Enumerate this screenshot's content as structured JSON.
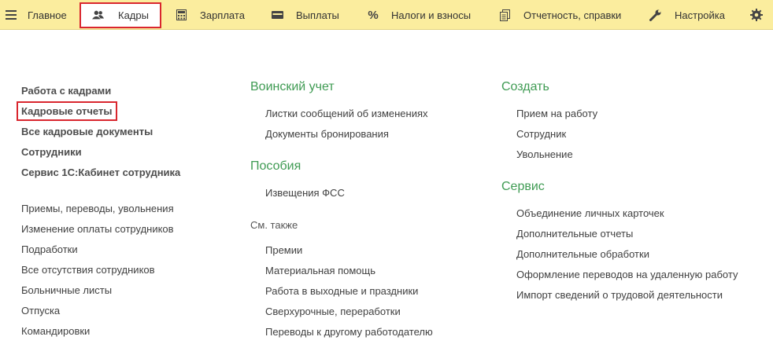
{
  "topbar": {
    "items": [
      {
        "label": "Главное",
        "icon": "hamburger-menu-icon"
      },
      {
        "label": "Кадры",
        "icon": "people-icon",
        "active": true
      },
      {
        "label": "Зарплата",
        "icon": "calculator-icon"
      },
      {
        "label": "Выплаты",
        "icon": "wallet-icon"
      },
      {
        "label": "Налоги и взносы",
        "icon": "percent-icon"
      },
      {
        "label": "Отчетность, справки",
        "icon": "documents-icon"
      },
      {
        "label": "Настройка",
        "icon": "wrench-icon"
      }
    ],
    "settings_icon": "gear-icon",
    "colors": {
      "bar": "#fbed9e",
      "highlight": "#d9262e"
    }
  },
  "left": {
    "primary": [
      "Работа с кадрами",
      "Кадровые отчеты",
      "Все кадровые документы",
      "Сотрудники",
      "Сервис 1С:Кабинет сотрудника"
    ],
    "secondary": [
      "Приемы, переводы, увольнения",
      "Изменение оплаты сотрудников",
      "Подработки",
      "Все отсутствия сотрудников",
      "Больничные листы",
      "Отпуска",
      "Командировки"
    ]
  },
  "middle": {
    "military": {
      "title": "Воинский учет",
      "items": [
        "Листки сообщений об изменениях",
        "Документы бронирования"
      ]
    },
    "benefits": {
      "title": "Пособия",
      "items": [
        "Извещения ФСС"
      ]
    },
    "see_also": {
      "title": "См. также",
      "items": [
        "Премии",
        "Материальная помощь",
        "Работа в выходные и праздники",
        "Сверхурочные, переработки",
        "Переводы к другому работодателю"
      ]
    }
  },
  "right": {
    "create": {
      "title": "Создать",
      "items": [
        "Прием на работу",
        "Сотрудник",
        "Увольнение"
      ]
    },
    "service": {
      "title": "Сервис",
      "items": [
        "Объединение личных карточек",
        "Дополнительные отчеты",
        "Дополнительные обработки",
        "Оформление переводов на удаленную работу",
        "Импорт сведений о трудовой деятельности"
      ]
    }
  }
}
